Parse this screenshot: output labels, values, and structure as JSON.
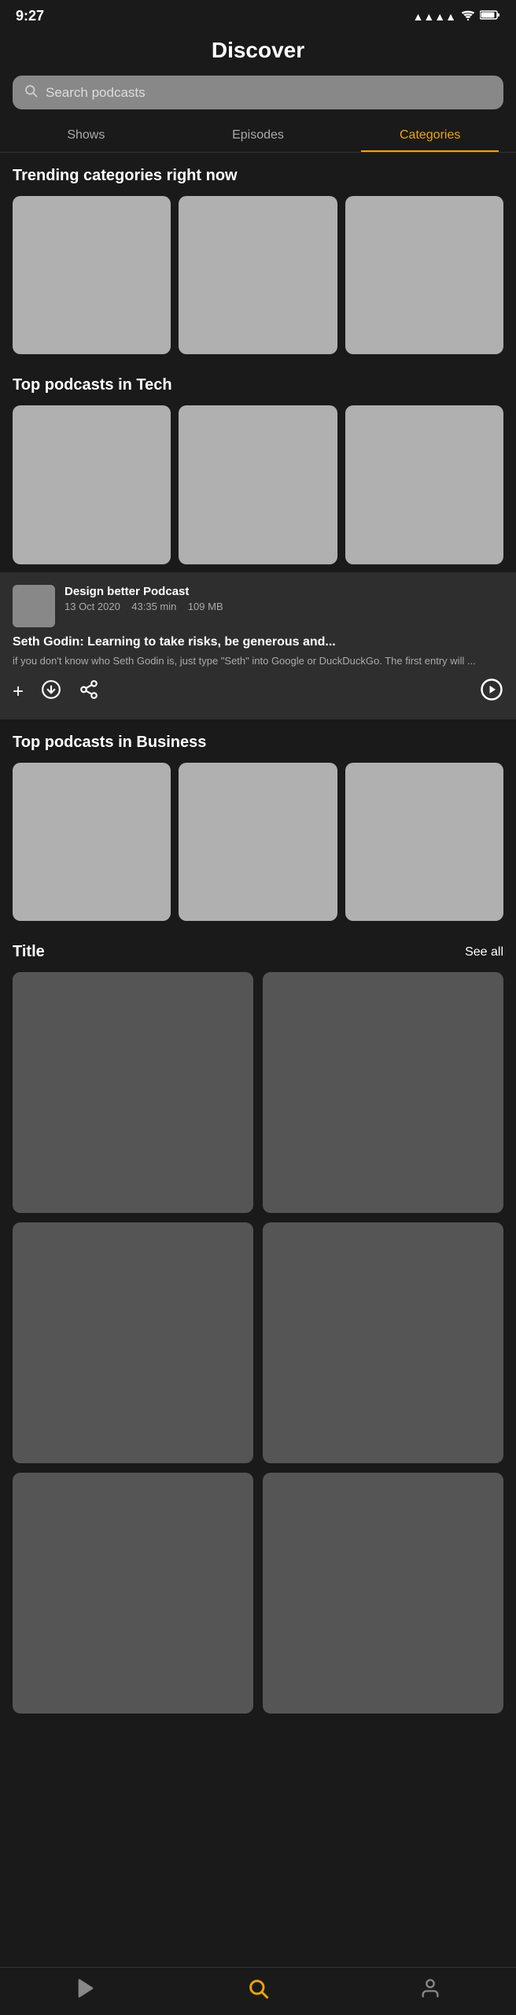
{
  "statusBar": {
    "time": "9:27",
    "signal": "●●●●",
    "wifi": "wifi",
    "battery": "battery"
  },
  "header": {
    "title": "Discover"
  },
  "search": {
    "placeholder": "Search podcasts"
  },
  "tabs": [
    {
      "label": "Shows",
      "active": false
    },
    {
      "label": "Episodes",
      "active": false
    },
    {
      "label": "Categories",
      "active": true
    }
  ],
  "trendingSection": {
    "title": "Trending categories right now"
  },
  "topTechSection": {
    "title": "Top podcasts in Tech"
  },
  "featuredEpisode": {
    "podcastName": "Design better Podcast",
    "date": "13 Oct 2020",
    "duration": "43:35 min",
    "size": "109 MB",
    "episodeTitle": "Seth Godin: Learning to take risks, be generous and...",
    "description": "if you don't know who Seth Godin is, just type \"Seth\" into Google or DuckDuckGo.  The first entry will ..."
  },
  "topBusinessSection": {
    "title": "Top podcasts in Business"
  },
  "titleSection": {
    "label": "Title",
    "seeAll": "See all"
  },
  "bottomNav": [
    {
      "icon": "▶",
      "label": "play",
      "active": false
    },
    {
      "icon": "⌕",
      "label": "search",
      "active": true
    },
    {
      "icon": "👤",
      "label": "profile",
      "active": false
    }
  ]
}
